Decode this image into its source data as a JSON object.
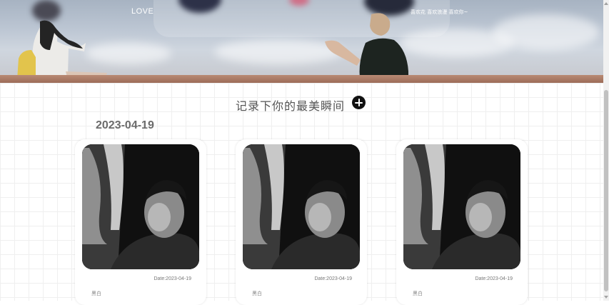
{
  "header": {
    "logo": "LOVE",
    "slogan": "喜欢花 喜欢浪漫 喜欢你~"
  },
  "section": {
    "title": "记录下你的最美瞬间",
    "add_icon": "plus-circle-icon"
  },
  "group": {
    "date": "2023-04-19"
  },
  "cards": [
    {
      "date": "Date:2023-04-19",
      "tag": "黑白",
      "photo": "black-and-white portrait photo"
    },
    {
      "date": "Date:2023-04-19",
      "tag": "黑白",
      "photo": "black-and-white portrait photo"
    },
    {
      "date": "Date:2023-04-19",
      "tag": "黑白",
      "photo": "black-and-white portrait photo"
    }
  ],
  "colors": {
    "add_button": "#111111",
    "grid_line": "#efefef",
    "date_heading": "#6b6b6b"
  }
}
